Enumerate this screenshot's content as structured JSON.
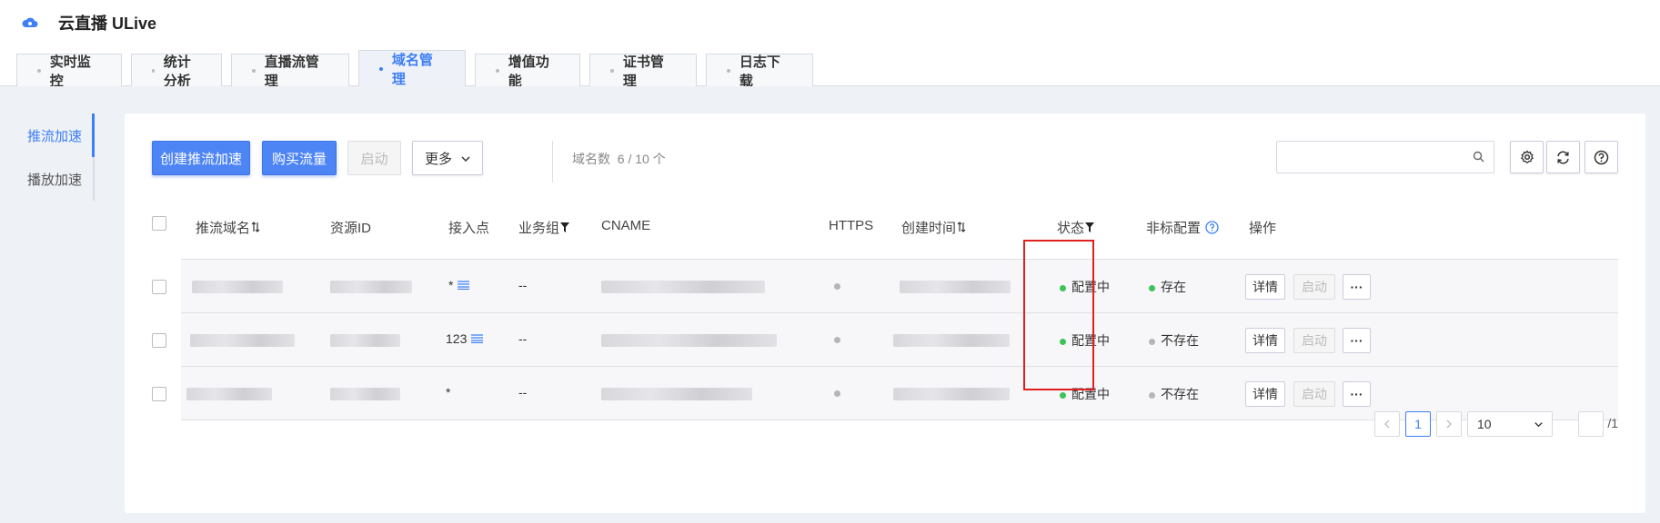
{
  "app": {
    "title": "云直播 ULive"
  },
  "tabs": [
    {
      "label": "实时监控"
    },
    {
      "label": "统计分析"
    },
    {
      "label": "直播流管理"
    },
    {
      "label": "域名管理"
    },
    {
      "label": "增值功能"
    },
    {
      "label": "证书管理"
    },
    {
      "label": "日志下载"
    }
  ],
  "sidenav": [
    {
      "label": "推流加速"
    },
    {
      "label": "播放加速"
    }
  ],
  "toolbar": {
    "create_label": "创建推流加速",
    "buy_label": "购买流量",
    "start_label": "启动",
    "more_label": "更多",
    "count_label": "域名数",
    "count_value": "6 / 10 个",
    "search_placeholder": ""
  },
  "table": {
    "headers": {
      "domain": "推流域名",
      "resource_id": "资源ID",
      "access_point": "接入点",
      "business_group": "业务组",
      "cname": "CNAME",
      "https": "HTTPS",
      "created_time": "创建时间",
      "status": "状态",
      "nonstandard": "非标配置",
      "actions": "操作"
    },
    "rows": [
      {
        "access_point": "*",
        "business_group": "--",
        "status": "配置中",
        "nonstandard": "存在",
        "detail": "详情",
        "start": "启动",
        "more": "···"
      },
      {
        "access_point": "123",
        "business_group": "--",
        "status": "配置中",
        "nonstandard": "不存在",
        "detail": "详情",
        "start": "启动",
        "more": "···"
      },
      {
        "access_point": "*",
        "business_group": "--",
        "status": "配置中",
        "nonstandard": "不存在",
        "detail": "详情",
        "start": "启动",
        "more": "···"
      }
    ]
  },
  "pager": {
    "current_page": "1",
    "page_size": "10",
    "total": "/1"
  },
  "colors": {
    "accent": "#3d7ff7",
    "status_green": "#3cc35a",
    "status_gray": "#b5b5b5",
    "highlight_red": "#e02020"
  }
}
